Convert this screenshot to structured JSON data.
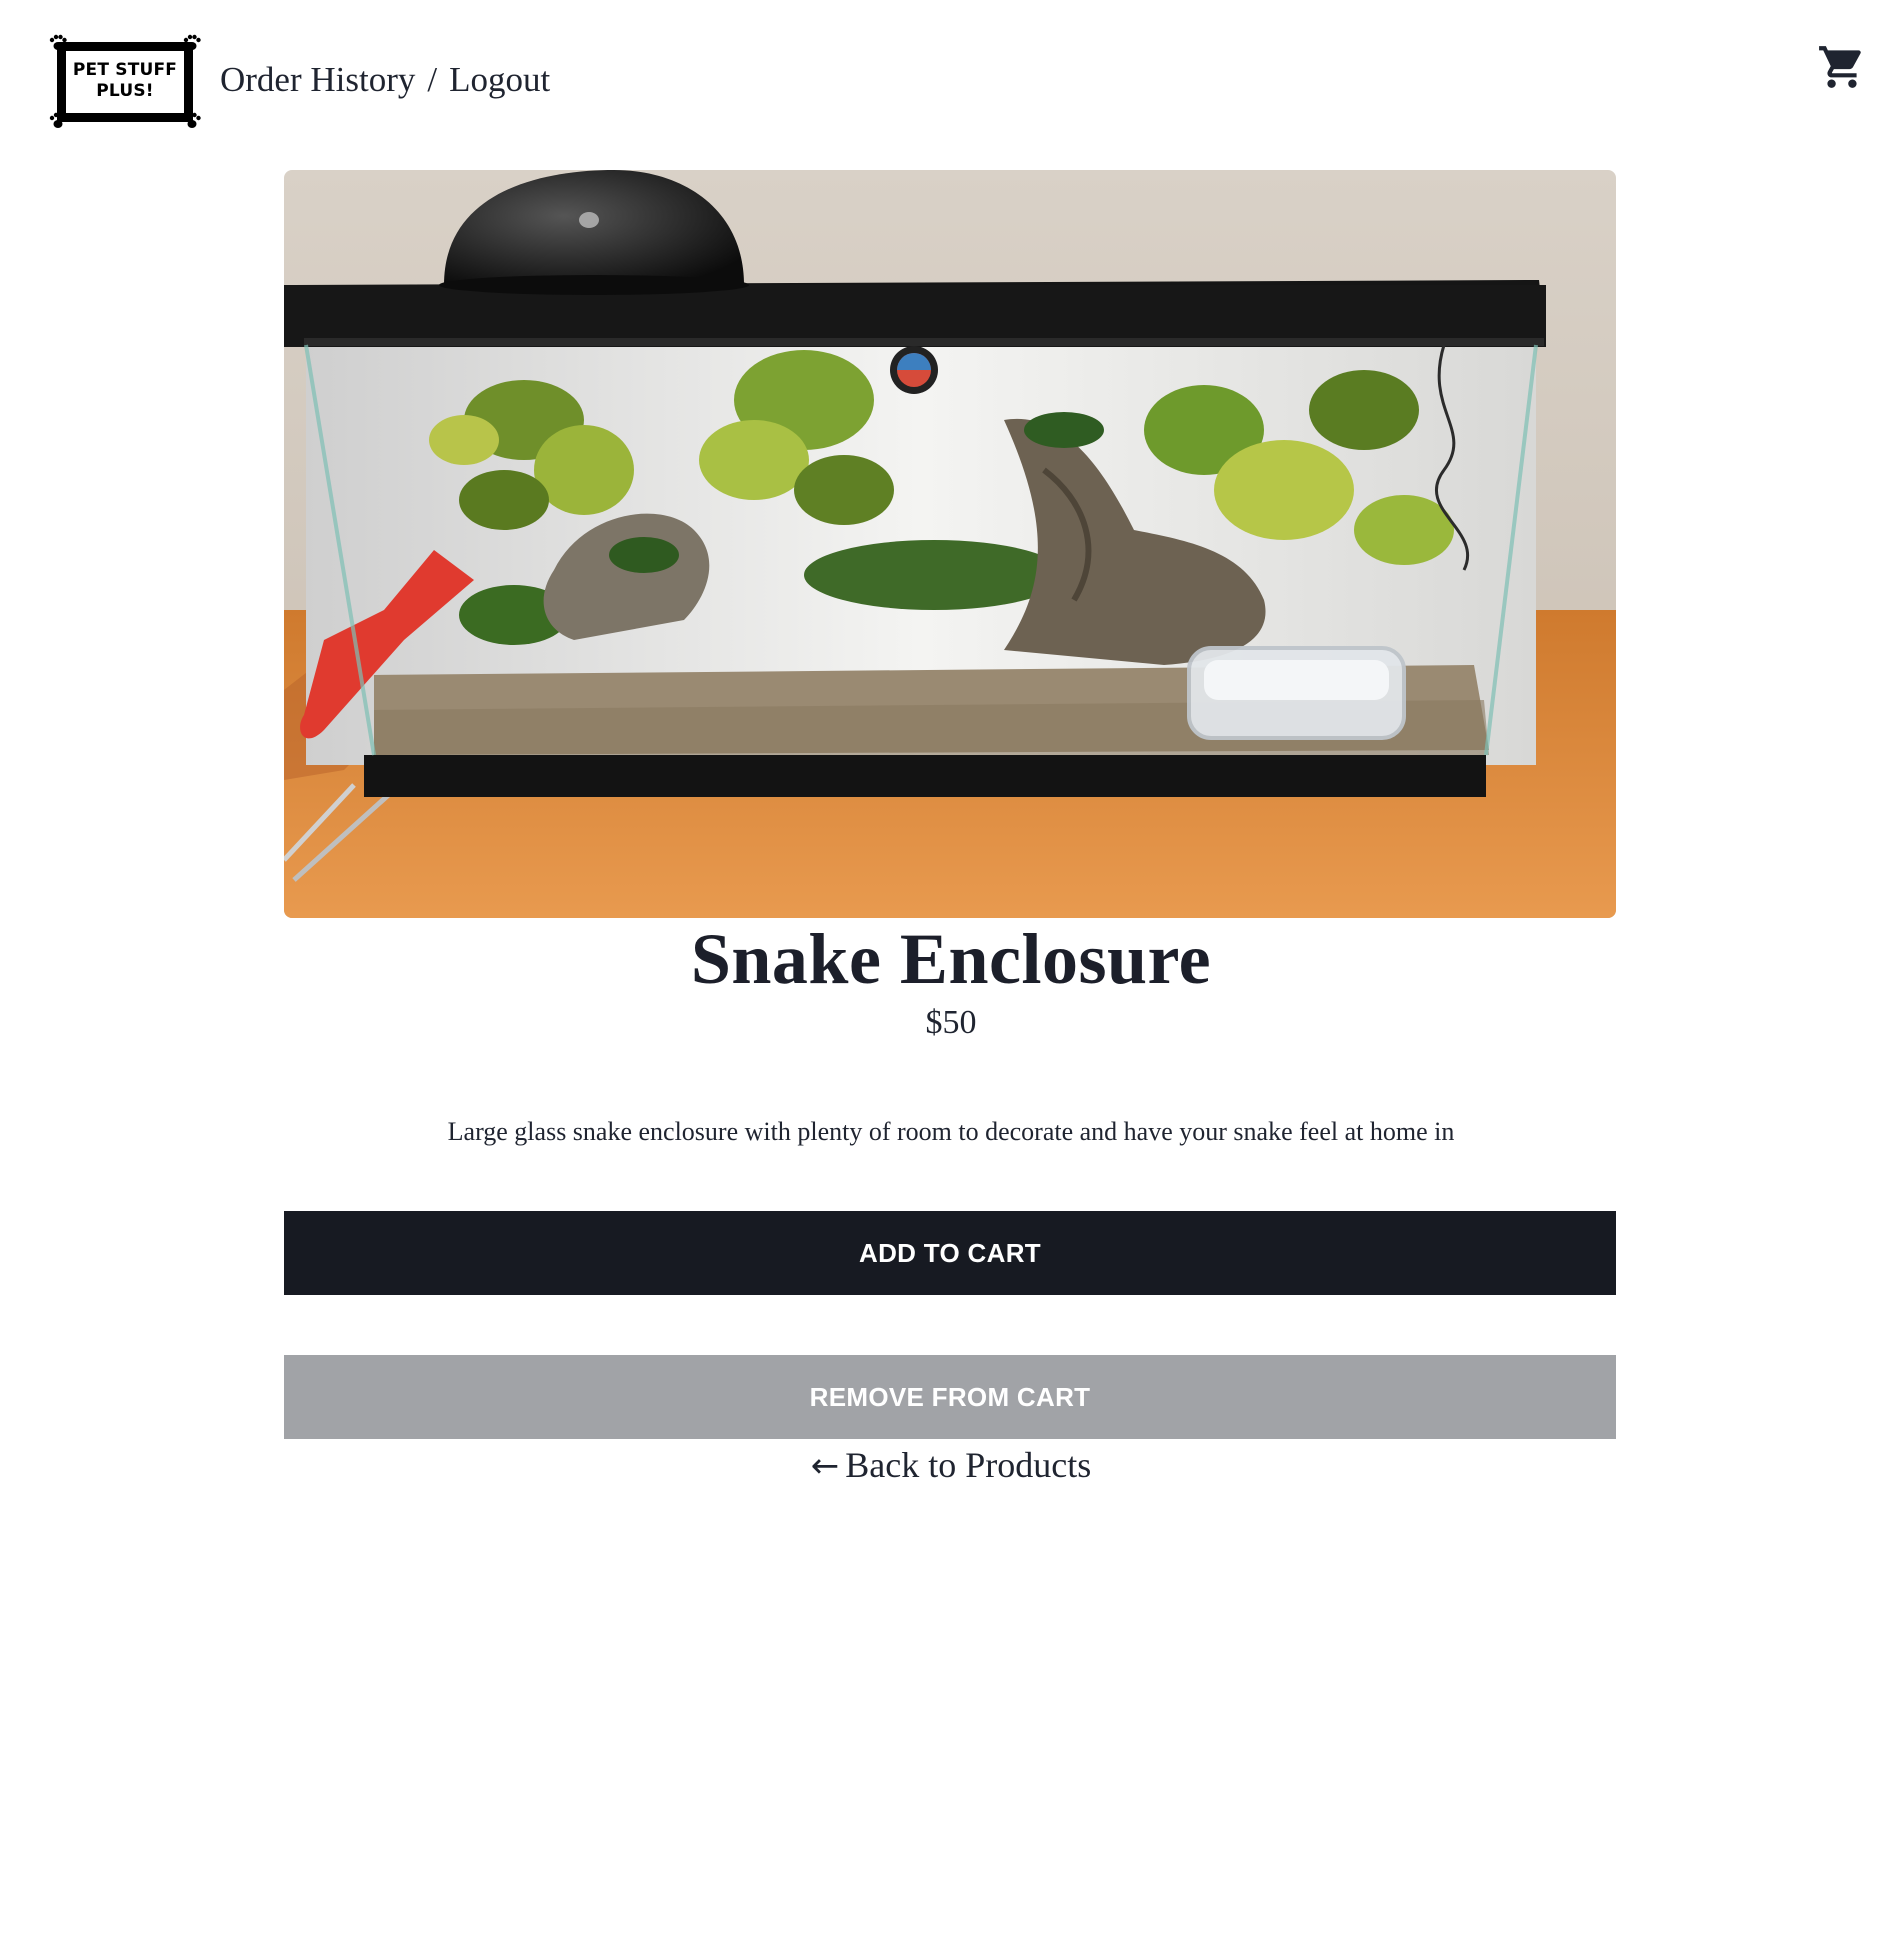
{
  "header": {
    "logo_line1": "PET STUFF",
    "logo_line2": "PLUS!",
    "nav_order_history": "Order History",
    "nav_separator": "/",
    "nav_logout": "Logout",
    "cart_icon": "shopping-cart-icon"
  },
  "product": {
    "image_alt": "glass snake terrarium with plants, logs, heat lamp and water dish",
    "name": "Snake Enclosure",
    "price": "$50",
    "description": "Large glass snake enclosure with plenty of room to decorate and have your snake feel at home in"
  },
  "actions": {
    "add_to_cart": "ADD TO CART",
    "remove_from_cart": "REMOVE FROM CART",
    "back_arrow": "←",
    "back_label": "Back to Products"
  },
  "colors": {
    "primary_button": "#171a22",
    "secondary_button": "#a1a3a7",
    "text": "#1f2430"
  }
}
